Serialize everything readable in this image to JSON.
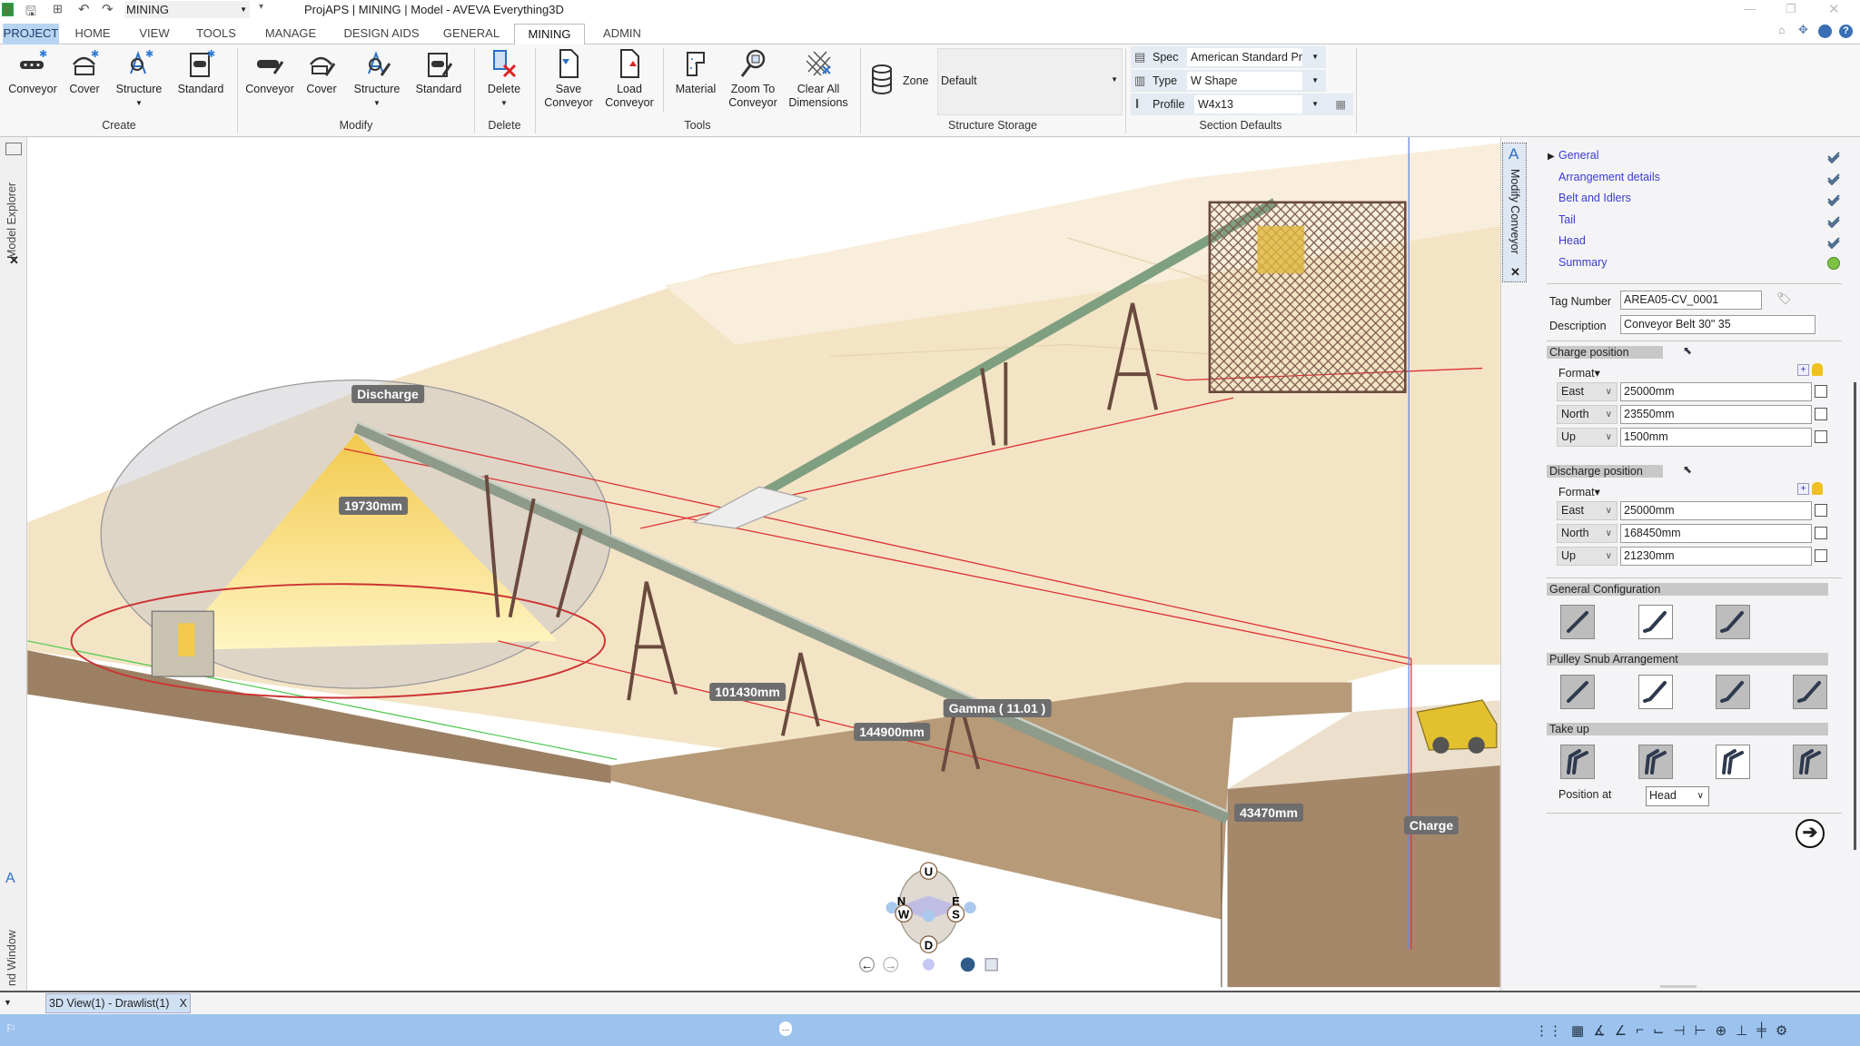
{
  "titlebar": {
    "workspace": "MINING",
    "title": "ProjAPS | MINING | Model - AVEVA Everything3D"
  },
  "tabs": [
    "PROJECT",
    "HOME",
    "VIEW",
    "TOOLS",
    "MANAGE",
    "DESIGN AIDS",
    "GENERAL",
    "MINING",
    "ADMIN"
  ],
  "ribbon": {
    "create": {
      "label": "Create",
      "conveyor": "Conveyor",
      "cover": "Cover",
      "structure": "Structure",
      "standard": "Standard"
    },
    "modify": {
      "label": "Modify",
      "conveyor": "Conveyor",
      "cover": "Cover",
      "structure": "Structure",
      "standard": "Standard"
    },
    "delete": {
      "label": "Delete",
      "button": "Delete"
    },
    "tools": {
      "label": "Tools",
      "save1": "Save",
      "save2": "Conveyor",
      "load1": "Load",
      "load2": "Conveyor",
      "material": "Material",
      "zoom1": "Zoom To",
      "zoom2": "Conveyor",
      "clear1": "Clear All",
      "clear2": "Dimensions"
    },
    "storage": {
      "label": "Structure Storage",
      "zone_label": "Zone",
      "zone_value": "Default"
    },
    "section": {
      "label": "Section Defaults",
      "spec_label": "Spec",
      "spec_value": "American Standard Pr",
      "type_label": "Type",
      "type_value": "W Shape",
      "profile_label": "Profile",
      "profile_value": "W4x13"
    }
  },
  "docks": {
    "model_explorer": "Model Explorer",
    "window": "nd Window",
    "modify_conveyor": "Modify Conveyor"
  },
  "viewport": {
    "labels": {
      "discharge": "Discharge",
      "height": "19730mm",
      "len1": "101430mm",
      "len2": "144900mm",
      "gamma": "Gamma ( 11.01 )",
      "len3": "43470mm",
      "charge": "Charge"
    },
    "compass": {
      "up": "U",
      "down": "D",
      "north": "N",
      "south": "S",
      "east": "E",
      "west": "W"
    }
  },
  "panel": {
    "nav": [
      {
        "label": "General",
        "done": true
      },
      {
        "label": "Arrangement details",
        "done": true
      },
      {
        "label": "Belt and Idlers",
        "done": true
      },
      {
        "label": "Tail",
        "done": true
      },
      {
        "label": "Head",
        "done": true
      },
      {
        "label": "Summary",
        "done": false
      }
    ],
    "tag_label": "Tag Number",
    "tag_value": "AREA05-CV_0001",
    "desc_label": "Description",
    "desc_value": "Conveyor Belt 30\" 35",
    "format_label": "Format▾",
    "charge": {
      "header": "Charge position",
      "rows": [
        {
          "axis": "East",
          "value": "25000mm"
        },
        {
          "axis": "North",
          "value": "23550mm"
        },
        {
          "axis": "Up",
          "value": "1500mm"
        }
      ]
    },
    "discharge": {
      "header": "Discharge position",
      "rows": [
        {
          "axis": "East",
          "value": "25000mm"
        },
        {
          "axis": "North",
          "value": "168450mm"
        },
        {
          "axis": "Up",
          "value": "21230mm"
        }
      ]
    },
    "general_config": "General Configuration",
    "pulley_snub": "Pulley Snub Arrangement",
    "take_up": "Take up",
    "position_label": "Position at",
    "position_value": "Head"
  },
  "bottom": {
    "view_tab": "3D View(1) - Drawlist(1)",
    "close": "X"
  },
  "colors": {
    "accent": "#9cc3ee",
    "link": "#3a3ad6",
    "status_ok": "#7dc242"
  }
}
